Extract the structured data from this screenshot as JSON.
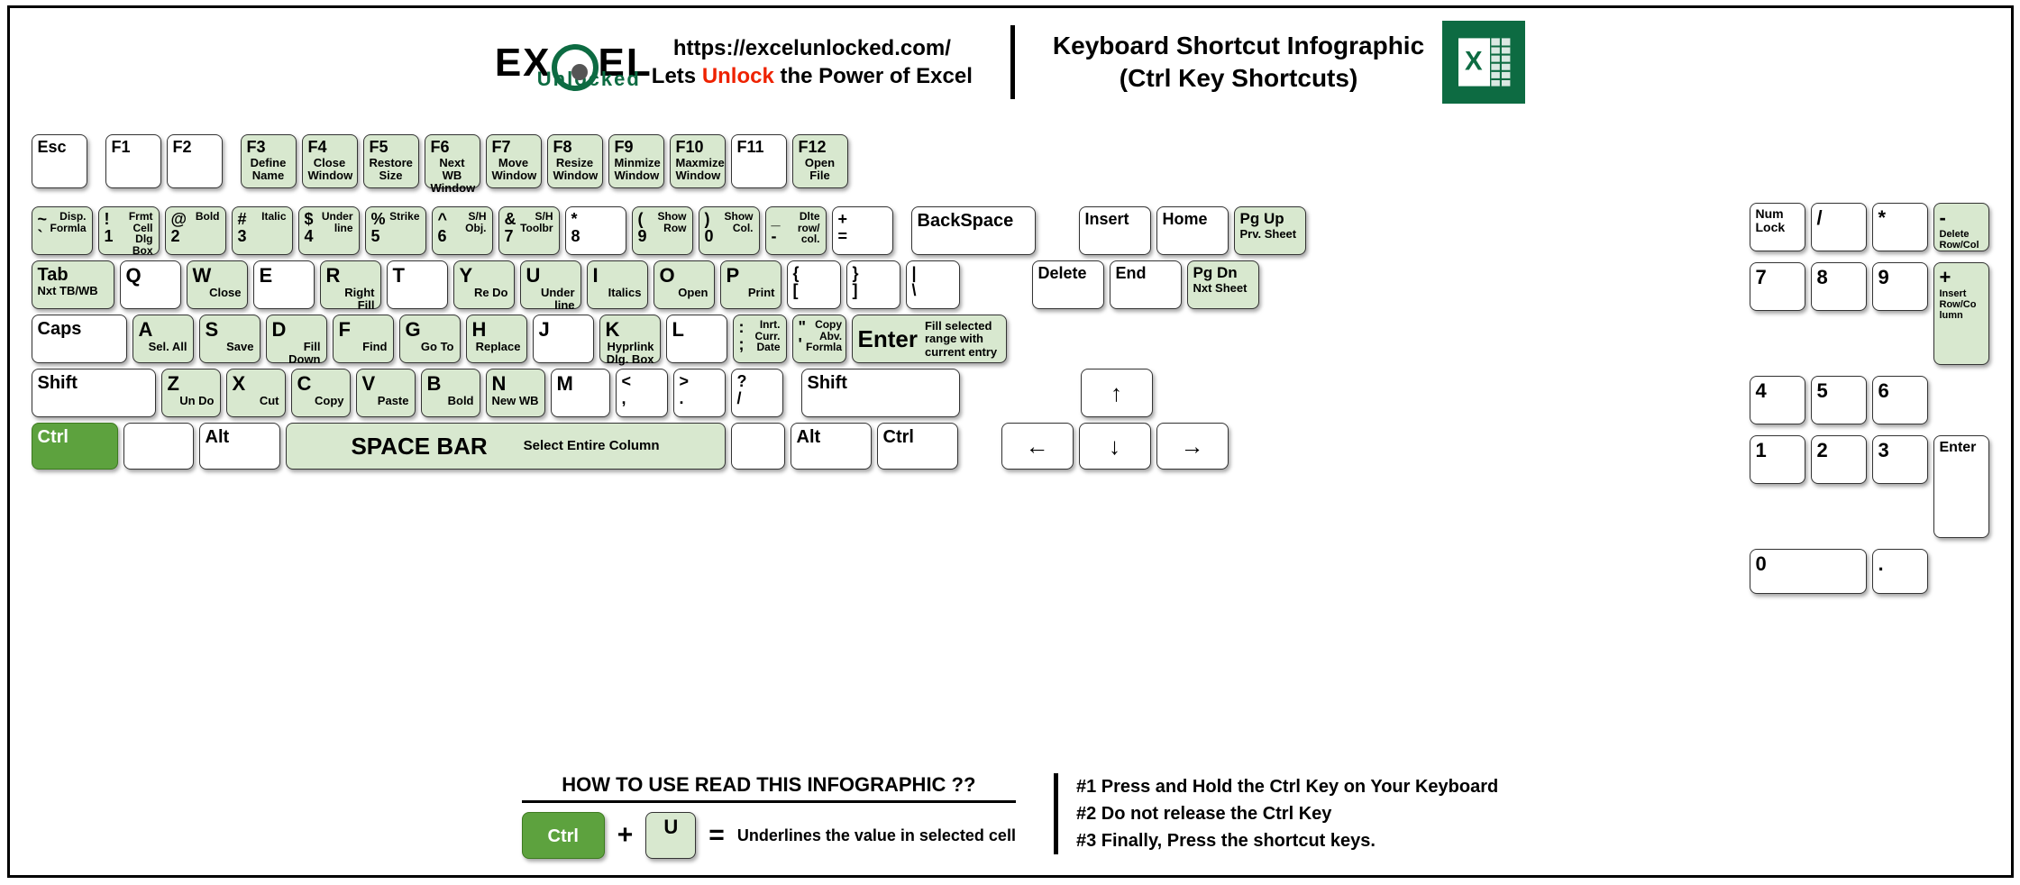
{
  "header": {
    "logo_excel": "EX   EL",
    "logo_sub": "Unlocked",
    "url": "https://excelunlocked.com/",
    "tagline_pre": "Lets ",
    "tagline_word": "Unlock",
    "tagline_post": " the Power of Excel",
    "title_l1": "Keyboard Shortcut Infographic",
    "title_l2": "(Ctrl Key Shortcuts)"
  },
  "fn_row": [
    {
      "k": "Esc"
    },
    {
      "k": "F1"
    },
    {
      "k": "F2"
    },
    {
      "k": "F3",
      "d": "Define Name",
      "g": 1
    },
    {
      "k": "F4",
      "d": "Close Window",
      "g": 1
    },
    {
      "k": "F5",
      "d": "Restore Size",
      "g": 1
    },
    {
      "k": "F6",
      "d": "Next WB Window",
      "g": 1
    },
    {
      "k": "F7",
      "d": "Move Window",
      "g": 1
    },
    {
      "k": "F8",
      "d": "Resize Window",
      "g": 1
    },
    {
      "k": "F9",
      "d": "Minmize Window",
      "g": 1
    },
    {
      "k": "F10",
      "d": "Maxmize Window",
      "g": 1
    },
    {
      "k": "F11"
    },
    {
      "k": "F12",
      "d": "Open File",
      "g": 1
    }
  ],
  "row1": [
    {
      "t1": "~",
      "d1": "Disp.",
      "t2": "`",
      "d2": "Formla",
      "g": 1
    },
    {
      "t1": "!",
      "d1": "Frmt",
      "t2": "1",
      "d2": "Cell Dlg Box",
      "g": 1
    },
    {
      "t1": "@",
      "d1": "",
      "t2": "2",
      "d2": "Bold",
      "g": 1
    },
    {
      "t1": "#",
      "d1": "",
      "t2": "3",
      "d2": "Italic",
      "g": 1
    },
    {
      "t1": "$",
      "d1": "Under",
      "t2": "4",
      "d2": "line",
      "g": 1
    },
    {
      "t1": "%",
      "d1": "",
      "t2": "5",
      "d2": "Strike",
      "g": 1
    },
    {
      "t1": "^",
      "d1": "S/H",
      "t2": "6",
      "d2": "Obj.",
      "g": 1
    },
    {
      "t1": "&",
      "d1": "S/H",
      "t2": "7",
      "d2": "Toolbr",
      "g": 1
    },
    {
      "t1": "*",
      "d1": "",
      "t2": "8",
      "d2": ""
    },
    {
      "t1": "(",
      "d1": "Show",
      "t2": "9",
      "d2": "Row",
      "g": 1
    },
    {
      "t1": ")",
      "d1": "Show",
      "t2": "0",
      "d2": "Col.",
      "g": 1
    },
    {
      "t1": "_",
      "d1": "Dlte",
      "t2": "-",
      "d2": "row/ col.",
      "g": 1
    },
    {
      "t1": "+",
      "d1": "",
      "t2": "=",
      "d2": ""
    }
  ],
  "row1_right": {
    "bksp": "BackSpace",
    "ins": "Insert",
    "home": "Home",
    "pgup": "Pg Up",
    "pgup_d": "Prv. Sheet"
  },
  "row2": [
    {
      "k": "Q"
    },
    {
      "k": "W",
      "d": "Close",
      "g": 1
    },
    {
      "k": "E"
    },
    {
      "k": "R",
      "d": "Right Fill",
      "g": 1
    },
    {
      "k": "T"
    },
    {
      "k": "Y",
      "d": "Re Do",
      "g": 1
    },
    {
      "k": "U",
      "d": "Under line",
      "g": 1
    },
    {
      "k": "I",
      "d": "Italics",
      "g": 1
    },
    {
      "k": "O",
      "d": "Open",
      "g": 1
    },
    {
      "k": "P",
      "d": "Print",
      "g": 1
    },
    {
      "t1": "{",
      "t2": "["
    },
    {
      "t1": "}",
      "t2": "]"
    },
    {
      "t1": "|",
      "t2": "\\"
    }
  ],
  "row2_left": {
    "tab": "Tab",
    "tab_d": "Nxt TB/WB"
  },
  "row2_right": {
    "del": "Delete",
    "end": "End",
    "pgdn": "Pg Dn",
    "pgdn_d": "Nxt Sheet"
  },
  "row3_left": "Caps",
  "row3": [
    {
      "k": "A",
      "d": "Sel. All",
      "g": 1
    },
    {
      "k": "S",
      "d": "Save",
      "g": 1
    },
    {
      "k": "D",
      "d": "Fill Down",
      "g": 1
    },
    {
      "k": "F",
      "d": "Find",
      "g": 1
    },
    {
      "k": "G",
      "d": "Go To",
      "g": 1
    },
    {
      "k": "H",
      "d": "Replace",
      "g": 1
    },
    {
      "k": "J"
    },
    {
      "k": "K",
      "d": "Hyprlink Dlg. Box",
      "g": 1
    },
    {
      "k": "L"
    },
    {
      "t1": ":",
      "d1": "Inrt.",
      "t2": ";",
      "d2": "Curr. Date",
      "g": 1
    },
    {
      "t1": "\"",
      "d1": "Copy",
      "t2": "'",
      "d2": "Abv. Formla",
      "g": 1
    }
  ],
  "row3_enter": {
    "k": "Enter",
    "d": "Fill selected range with current entry"
  },
  "row4_left": "Shift",
  "row4": [
    {
      "k": "Z",
      "d": "Un Do",
      "g": 1
    },
    {
      "k": "X",
      "d": "Cut",
      "g": 1
    },
    {
      "k": "C",
      "d": "Copy",
      "g": 1
    },
    {
      "k": "V",
      "d": "Paste",
      "g": 1
    },
    {
      "k": "B",
      "d": "Bold",
      "g": 1
    },
    {
      "k": "N",
      "d": "New WB",
      "g": 1
    },
    {
      "k": "M"
    },
    {
      "t1": "<",
      "t2": ","
    },
    {
      "t1": ">",
      "t2": "."
    },
    {
      "t1": "?",
      "t2": "/"
    }
  ],
  "row4_right": "Shift",
  "row5": {
    "ctrl": "Ctrl",
    "alt": "Alt",
    "space": "SPACE BAR",
    "space_d": "Select Entire Column"
  },
  "arrows": {
    "up": "↑",
    "left": "←",
    "down": "↓",
    "right": "→"
  },
  "numpad": {
    "r0": [
      "Num Lock",
      "/",
      "*"
    ],
    "minus": {
      "k": "-",
      "d": "Delete Row/Col",
      "g": 1
    },
    "r1": [
      "7",
      "8",
      "9"
    ],
    "plus": {
      "k": "+",
      "d": "Insert Row/Co lumn",
      "g": 1
    },
    "r2": [
      "4",
      "5",
      "6"
    ],
    "r3": [
      "1",
      "2",
      "3"
    ],
    "enter": "Enter",
    "r4": [
      "0",
      "."
    ]
  },
  "footer": {
    "howto_title": "HOW TO USE READ THIS INFOGRAPHIC ??",
    "demo_ctrl": "Ctrl",
    "demo_key": "U",
    "demo_txt": "Underlines the value in selected cell",
    "steps": [
      "#1 Press and Hold the Ctrl Key on Your Keyboard",
      "#2 Do not release the Ctrl Key",
      "#3 Finally, Press the shortcut keys."
    ]
  }
}
